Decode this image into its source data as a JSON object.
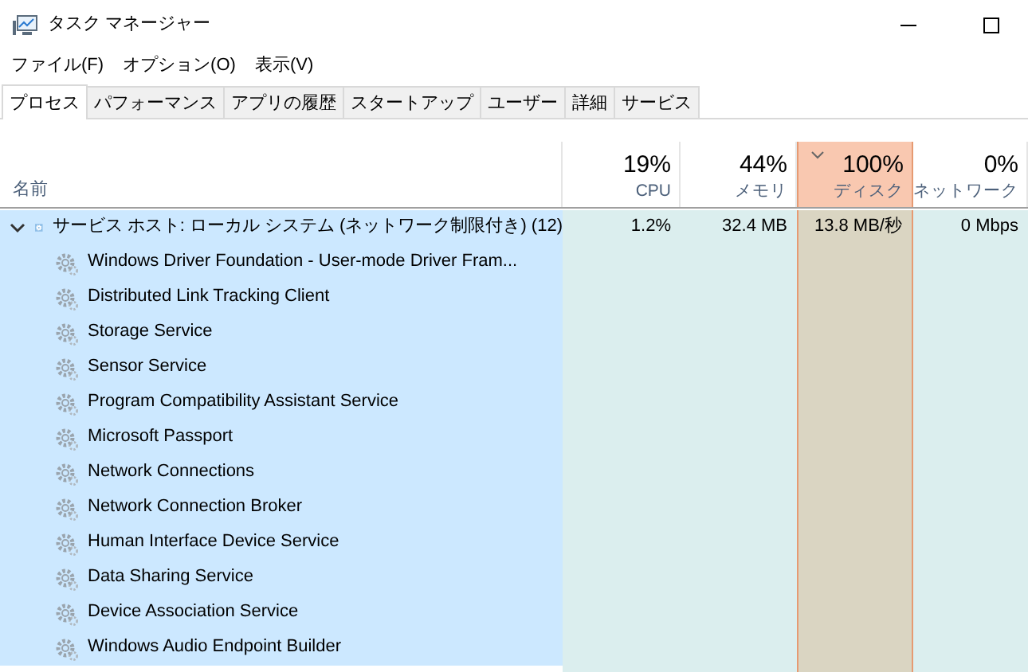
{
  "window": {
    "title": "タスク マネージャー"
  },
  "menu": [
    "ファイル(F)",
    "オプション(O)",
    "表示(V)"
  ],
  "tabs": [
    {
      "label": "プロセス",
      "selected": true
    },
    {
      "label": "パフォーマンス",
      "selected": false
    },
    {
      "label": "アプリの履歴",
      "selected": false
    },
    {
      "label": "スタートアップ",
      "selected": false
    },
    {
      "label": "ユーザー",
      "selected": false
    },
    {
      "label": "詳細",
      "selected": false
    },
    {
      "label": "サービス",
      "selected": false
    }
  ],
  "table": {
    "name_column": "名前",
    "columns": [
      {
        "percent": "19%",
        "label": "CPU",
        "sorted": false
      },
      {
        "percent": "44%",
        "label": "メモリ",
        "sorted": false
      },
      {
        "percent": "100%",
        "label": "ディスク",
        "sorted": true
      },
      {
        "percent": "0%",
        "label": "ネットワーク",
        "sorted": false
      }
    ],
    "group": {
      "name": "サービス ホスト: ローカル システム (ネットワーク制限付き) (12)",
      "expanded": true,
      "selected": true,
      "values": [
        "1.2%",
        "32.4 MB",
        "13.8 MB/秒",
        "0 Mbps"
      ],
      "children": [
        {
          "name": "Windows Driver Foundation - User-mode Driver Fram..."
        },
        {
          "name": "Distributed Link Tracking Client"
        },
        {
          "name": "Storage Service"
        },
        {
          "name": "Sensor Service"
        },
        {
          "name": "Program Compatibility Assistant Service"
        },
        {
          "name": "Microsoft Passport"
        },
        {
          "name": "Network Connections"
        },
        {
          "name": "Network Connection Broker"
        },
        {
          "name": "Human Interface Device Service"
        },
        {
          "name": "Data Sharing Service"
        },
        {
          "name": "Device Association Service"
        },
        {
          "name": "Windows Audio Endpoint Builder"
        }
      ]
    }
  }
}
